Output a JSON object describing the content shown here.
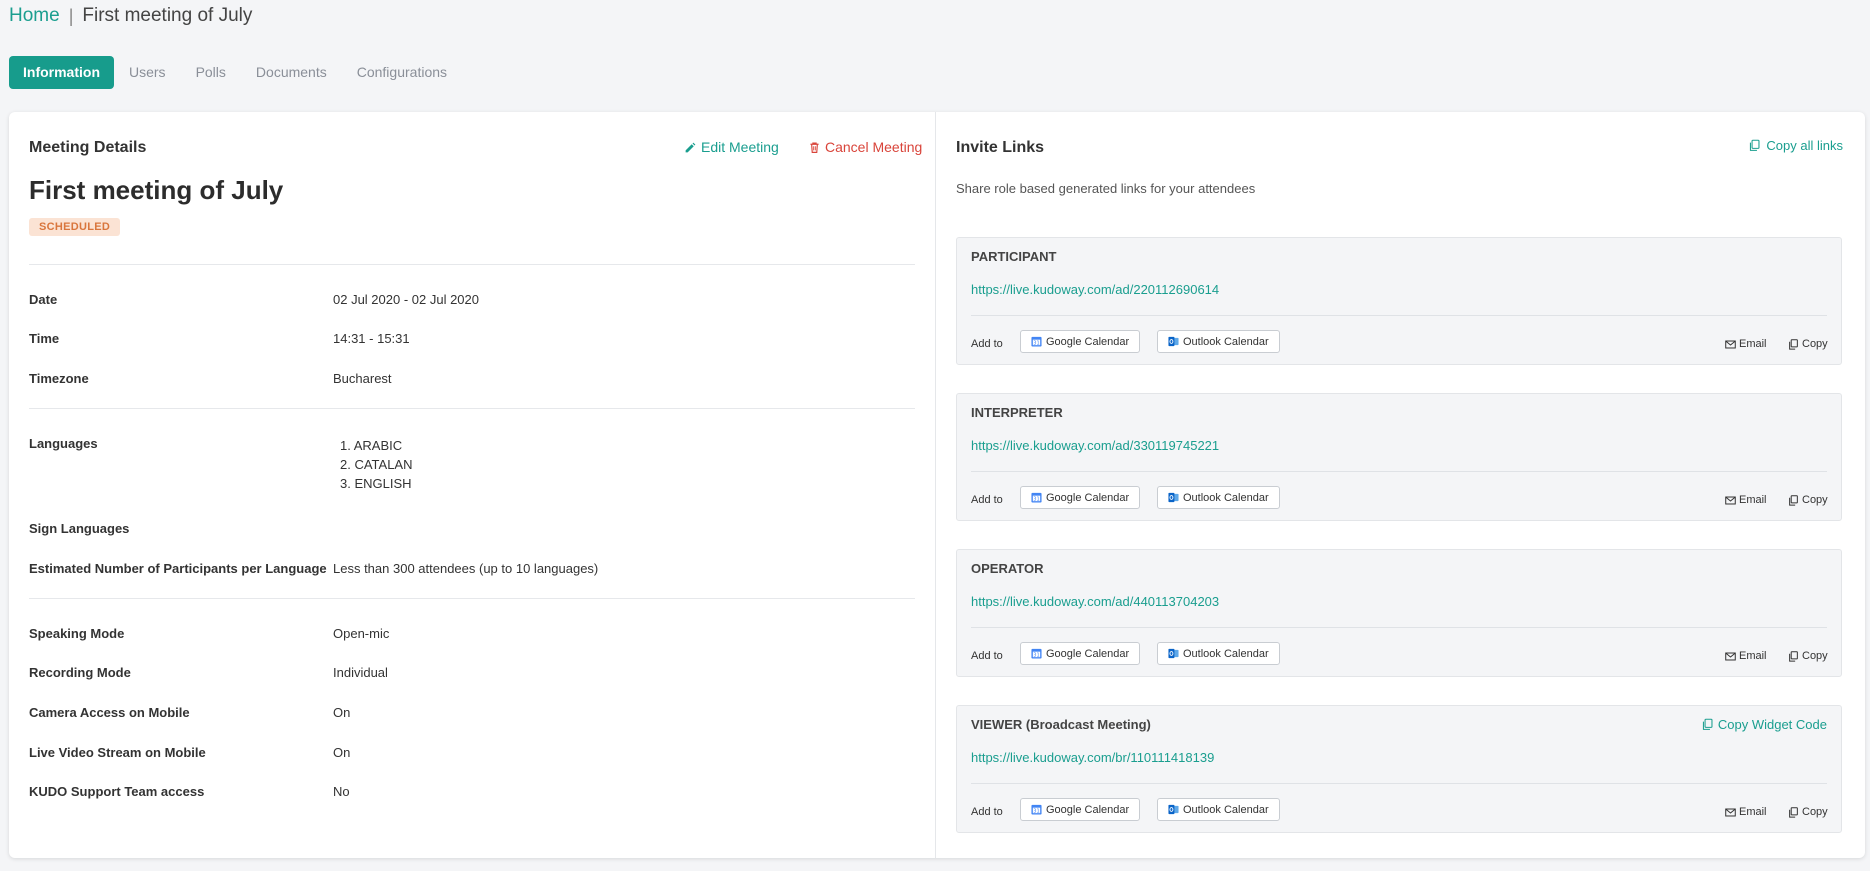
{
  "breadcrumb": {
    "home": "Home",
    "separator": "|",
    "current": "First meeting of July"
  },
  "tabs": [
    {
      "label": "Information",
      "active": true
    },
    {
      "label": "Users",
      "active": false
    },
    {
      "label": "Polls",
      "active": false
    },
    {
      "label": "Documents",
      "active": false
    },
    {
      "label": "Configurations",
      "active": false
    }
  ],
  "details": {
    "section_title": "Meeting Details",
    "edit_label": "Edit Meeting",
    "cancel_label": "Cancel Meeting",
    "meeting_title": "First meeting of July",
    "status": "SCHEDULED",
    "rows": {
      "date": {
        "label": "Date",
        "value": "02 Jul 2020 - 02 Jul 2020"
      },
      "time": {
        "label": "Time",
        "value": "14:31 - 15:31"
      },
      "timezone": {
        "label": "Timezone",
        "value": "Bucharest"
      },
      "languages": {
        "label": "Languages",
        "items": [
          "1. ARABIC",
          "2. CATALAN",
          "3. ENGLISH"
        ]
      },
      "sign_languages": {
        "label": "Sign Languages",
        "value": ""
      },
      "estimated": {
        "label": "Estimated Number of Participants per Language",
        "value": "Less than 300 attendees (up to 10 languages)"
      },
      "speaking": {
        "label": "Speaking Mode",
        "value": "Open-mic"
      },
      "recording": {
        "label": "Recording Mode",
        "value": "Individual"
      },
      "camera": {
        "label": "Camera Access on Mobile",
        "value": "On"
      },
      "live_video": {
        "label": "Live Video Stream on Mobile",
        "value": "On"
      },
      "support": {
        "label": "KUDO Support Team access",
        "value": "No"
      }
    }
  },
  "invites": {
    "section_title": "Invite Links",
    "copy_all_label": "Copy all links",
    "subtitle": "Share role based generated links for your attendees",
    "add_to_label": "Add to",
    "google_label": "Google Calendar",
    "outlook_label": "Outlook Calendar",
    "email_label": "Email",
    "copy_label": "Copy",
    "widget_label": "Copy Widget Code",
    "links": [
      {
        "role": "PARTICIPANT",
        "url": "https://live.kudoway.com/ad/220112690614"
      },
      {
        "role": "INTERPRETER",
        "url": "https://live.kudoway.com/ad/330119745221"
      },
      {
        "role": "OPERATOR",
        "url": "https://live.kudoway.com/ad/440113704203"
      },
      {
        "role": "VIEWER (Broadcast Meeting)",
        "url": "https://live.kudoway.com/br/110111418139"
      }
    ]
  },
  "colors": {
    "accent": "#179c8c",
    "danger": "#d9443a",
    "badge_bg": "#fbe3d4",
    "badge_text": "#d9763d",
    "google_blue": "#4285f4",
    "outlook_blue": "#0a64c8"
  }
}
